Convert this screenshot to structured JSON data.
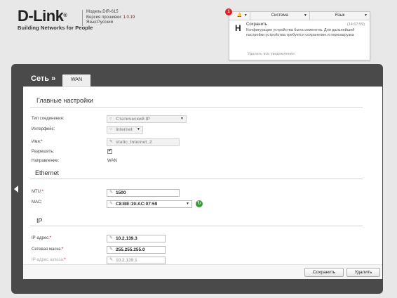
{
  "header": {
    "logo_main": "D-Link",
    "logo_reg": "®",
    "logo_sub": "Building Networks for People",
    "model": "Модель:DIR-615",
    "firmware_label": "Версия прошивки: ",
    "firmware_version": "1.0.19",
    "language": "Язык:Русский"
  },
  "notifications": {
    "badge_count": "1",
    "system_menu": "Система",
    "language_menu": "Язык",
    "item_title": "Сохранить",
    "item_time": "(14:07:59)",
    "item_text": "Конфигурация устройства была изменена. Для дальнейшей настройки устройства требуется сохранение и перезагрузка",
    "clear_link": "Удалить все уведомления"
  },
  "nav": {
    "breadcrumb": "Сеть »",
    "tab": "WAN"
  },
  "form": {
    "section_main": "Главные настройки",
    "conn_type_label": "Тип соединения:",
    "conn_type_value": "Статический IP",
    "interface_label": "Интерфейс:",
    "interface_value": "Internet",
    "name_label": "Имя:",
    "name_value": "static_Internet_2",
    "enable_label": "Разрешить:",
    "enable_checked": "✔",
    "direction_label": "Направление:",
    "direction_value": "WAN",
    "section_ethernet": "Ethernet",
    "mtu_label": "MTU:",
    "mtu_value": "1500",
    "mac_label": "MAC:",
    "mac_value": "C8:BE:19:AC:07:59",
    "section_ip": "IP",
    "ip_label": "IP-адрес:",
    "ip_value": "10.2.139.3",
    "mask_label": "Сетевая маска:",
    "mask_value": "255.255.255.0",
    "gw_label": "IP-адрес шлюза:",
    "gw_value": "10.2.139.1"
  },
  "buttons": {
    "save": "Сохранить",
    "delete": "Удалить"
  },
  "colors": {
    "panel": "#4a4a4a",
    "accent_red": "#cc0000",
    "refresh_green": "#3a9a3a"
  }
}
